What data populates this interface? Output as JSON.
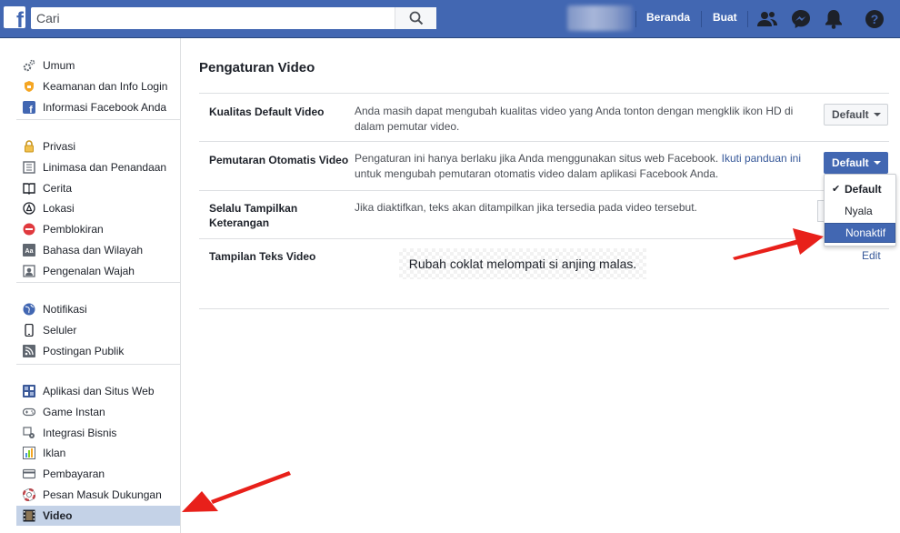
{
  "header": {
    "logo": "f",
    "search_placeholder": "Cari",
    "nav_home": "Beranda",
    "nav_create": "Buat",
    "icons": [
      "friends-icon",
      "messenger-icon",
      "notifications-icon",
      "help-icon"
    ],
    "brand_color": "#4267b2"
  },
  "sidebar": {
    "group1": [
      {
        "label": "Umum",
        "icon": "gear-icon"
      },
      {
        "label": "Keamanan dan Info Login",
        "icon": "shield-icon"
      },
      {
        "label": "Informasi Facebook Anda",
        "icon": "facebook-icon"
      }
    ],
    "group2": [
      {
        "label": "Privasi",
        "icon": "lock-icon"
      },
      {
        "label": "Linimasa dan Penandaan",
        "icon": "timeline-icon"
      },
      {
        "label": "Cerita",
        "icon": "book-icon"
      },
      {
        "label": "Lokasi",
        "icon": "location-icon"
      },
      {
        "label": "Pemblokiran",
        "icon": "block-icon"
      },
      {
        "label": "Bahasa dan Wilayah",
        "icon": "language-icon"
      },
      {
        "label": "Pengenalan Wajah",
        "icon": "face-icon"
      }
    ],
    "group3": [
      {
        "label": "Notifikasi",
        "icon": "globe-icon"
      },
      {
        "label": "Seluler",
        "icon": "mobile-icon"
      },
      {
        "label": "Postingan Publik",
        "icon": "rss-icon"
      }
    ],
    "group4": [
      {
        "label": "Aplikasi dan Situs Web",
        "icon": "apps-icon"
      },
      {
        "label": "Game Instan",
        "icon": "gamepad-icon"
      },
      {
        "label": "Integrasi Bisnis",
        "icon": "business-icon"
      },
      {
        "label": "Iklan",
        "icon": "ads-icon"
      },
      {
        "label": "Pembayaran",
        "icon": "card-icon"
      },
      {
        "label": "Pesan Masuk Dukungan",
        "icon": "lifebuoy-icon"
      },
      {
        "label": "Video",
        "icon": "film-icon",
        "active": true
      }
    ]
  },
  "main": {
    "title": "Pengaturan Video",
    "rows": [
      {
        "label": "Kualitas Default Video",
        "desc": "Anda masih dapat mengubah kualitas video yang Anda tonton dengan mengklik ikon HD di dalam pemutar video.",
        "button": "Default"
      },
      {
        "label": "Pemutaran Otomatis Video",
        "desc": "Pengaturan ini hanya berlaku jika Anda menggunakan situs web Facebook.",
        "desc_link": "Ikuti panduan ini",
        "desc_tail": "untuk mengubah pemutaran otomatis video dalam aplikasi Facebook Anda.",
        "button": "Default"
      },
      {
        "label_line1": "Selalu Tampilkan",
        "label_line2": "Keterangan",
        "desc": "Jika diaktifkan, teks akan ditampilkan jika tersedia pada video tersebut."
      },
      {
        "label": "Tampilan Teks Video",
        "sample": "Rubah coklat melompati si anjing malas.",
        "edit": "Edit"
      }
    ],
    "dropdown": {
      "options": [
        "Default",
        "Nyala",
        "Nonaktif"
      ],
      "selected": "Default",
      "highlighted": "Nonaktif"
    }
  },
  "annotations": {
    "arrow_color": "#e8201a"
  }
}
